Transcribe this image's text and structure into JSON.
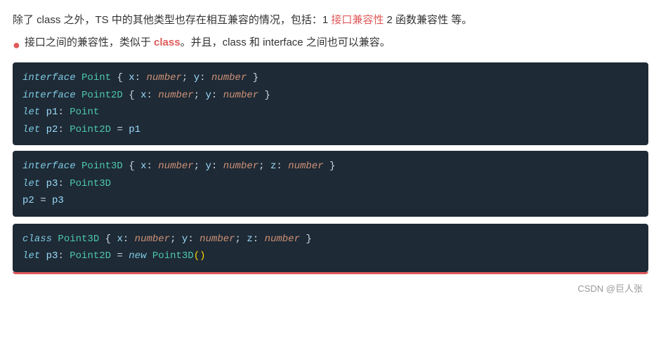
{
  "intro": {
    "text1": "除了 class 之外，TS 中的其他类型也存在相互兼容的情况，包括：1 ",
    "link1": "接口兼容性",
    "text2": " 2 函数兼容性 等。"
  },
  "bullet": {
    "dot": "●",
    "text1": "接口之间的兼容性，类似于 ",
    "class_highlight": "class",
    "text2": "。并且，class 和 interface 之间也可以兼容。"
  },
  "codeBlock1": {
    "lines": [
      {
        "kw": "interface",
        "rest": " Point",
        "brace_open": " { ",
        "props": "x: ",
        "type1": "number",
        "sep1": "; ",
        "prop2": "y: ",
        "type2": "number",
        "brace_close": " }"
      },
      {
        "kw": "interface",
        "rest": " Point2D",
        "brace_open": " { ",
        "props": "x: ",
        "type1": "number",
        "sep1": "; ",
        "prop2": "y: ",
        "type2": "number",
        "brace_close": " }"
      },
      {
        "kw": "let",
        "rest": " p1",
        "colon": ": ",
        "type": "Point"
      },
      {
        "kw": "let",
        "rest": " p2",
        "colon": ": ",
        "type": "Point2D",
        "eq": " = ",
        "val": "p1"
      }
    ]
  },
  "codeBlock2": {
    "lines": [
      {
        "kw": "interface",
        "rest": " Point3D",
        "brace_open": " { ",
        "props": "x: ",
        "type1": "number",
        "sep1": "; ",
        "prop2": "y: ",
        "type2": "number",
        "sep2": "; ",
        "prop3": "z: ",
        "type3": "number",
        "brace_close": " }"
      },
      {
        "kw": "let",
        "rest": " p3",
        "colon": ": ",
        "type": "Point3D"
      },
      {
        "plain": "p2 = p3"
      }
    ]
  },
  "codeBlock3": {
    "line1": {
      "kw": "class",
      "rest": " Point3D",
      "brace_open": " { ",
      "props": "x: ",
      "type1": "number",
      "sep1": "; ",
      "prop2": "y: ",
      "type2": "number",
      "sep2": "; ",
      "prop3": "z: ",
      "type3": "number",
      "brace_close": " }"
    },
    "line2": {
      "kw": "let",
      "rest": " p3",
      "colon": ": ",
      "type": "Point2D",
      "eq": " = ",
      "new_kw": "new ",
      "cls": "Point3D",
      "parens": "()"
    }
  },
  "watermark": "CSDN @巨人张"
}
